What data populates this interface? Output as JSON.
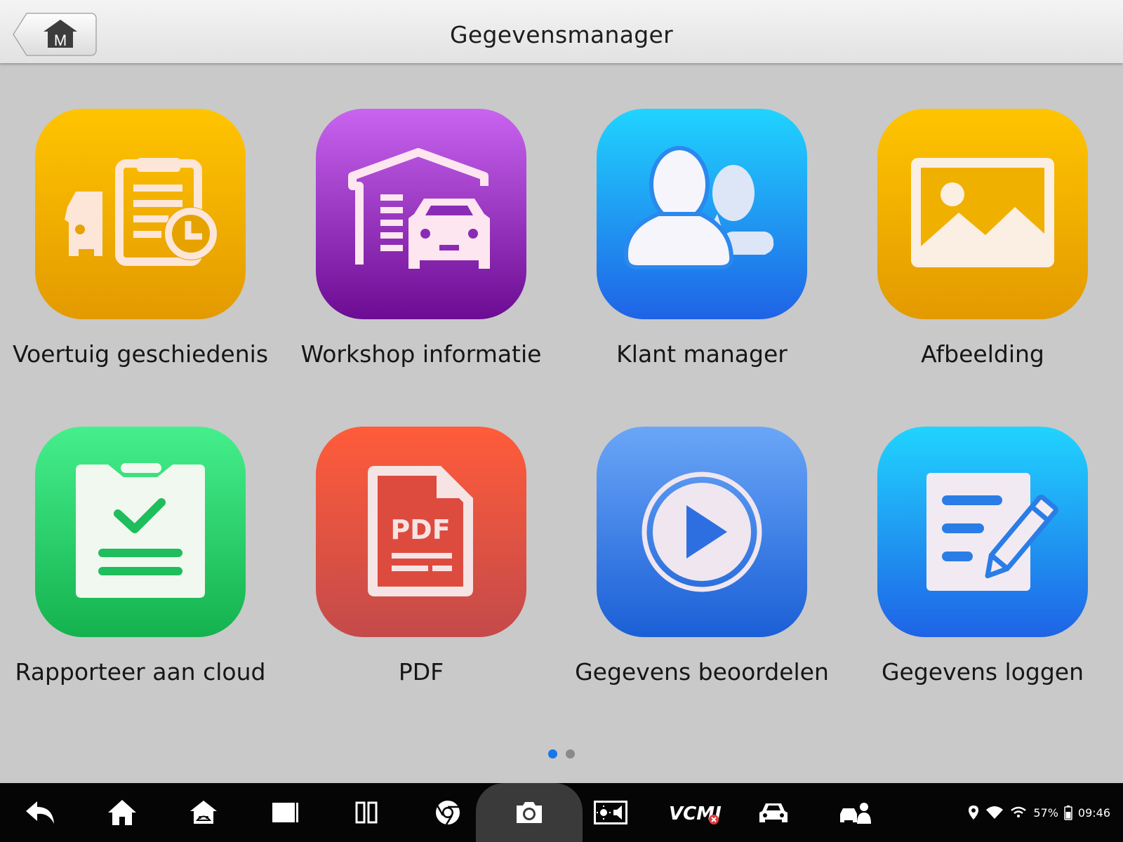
{
  "header": {
    "title": "Gegevensmanager",
    "home_button_letter": "M",
    "home_icon": "home-m-icon"
  },
  "tiles": [
    {
      "label": "Voertuig geschiedenis",
      "icon": "vehicle-history-icon",
      "color_top": "#ffc400",
      "color_bottom": "#e39a00"
    },
    {
      "label": "Workshop informatie",
      "icon": "workshop-garage-icon",
      "color_top": "#c864f0",
      "color_bottom": "#6c0c92"
    },
    {
      "label": "Klant manager",
      "icon": "customers-icon",
      "color_top": "#20d4ff",
      "color_bottom": "#1f63e6"
    },
    {
      "label": "Afbeelding",
      "icon": "image-icon",
      "color_top": "#ffc400",
      "color_bottom": "#e39a00"
    },
    {
      "label": "Rapporteer aan cloud",
      "icon": "report-clipboard-icon",
      "color_top": "#45ef8c",
      "color_bottom": "#14b24e"
    },
    {
      "label": "PDF",
      "icon": "pdf-file-icon",
      "color_top": "#ff5c3a",
      "color_bottom": "#c44a4a"
    },
    {
      "label": "Gegevens beoordelen",
      "icon": "play-review-icon",
      "color_top": "#6aa6f7",
      "color_bottom": "#1a5fd6"
    },
    {
      "label": "Gegevens loggen",
      "icon": "log-edit-icon",
      "color_top": "#20d4ff",
      "color_bottom": "#1f63e6"
    }
  ],
  "pdf_icon_text": "PDF",
  "pagination": {
    "pages": 2,
    "current": 1,
    "active_color": "#1976e8",
    "inactive_color": "#8a8a8a"
  },
  "navbar": {
    "buttons": [
      "back-icon",
      "home-icon",
      "autel-home-icon",
      "recent-apps-icon",
      "split-screen-icon",
      "chrome-icon",
      "camera-icon",
      "brightness-volume-icon",
      "vcmi-icon",
      "vehicle-icon",
      "remote-expert-icon"
    ],
    "vcmi_label": "VCMI"
  },
  "status_bar": {
    "battery_percent": "57%",
    "time": "09:46",
    "icons": [
      "location-icon",
      "wifi-icon",
      "vcmi-wifi-icon",
      "battery-icon"
    ]
  }
}
